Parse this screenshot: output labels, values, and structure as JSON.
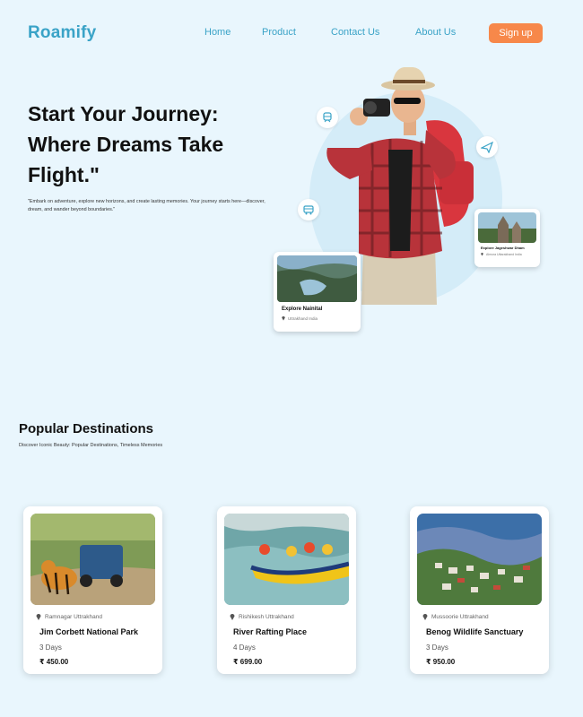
{
  "header": {
    "logo": "Roamify",
    "nav": [
      "Home",
      "Product",
      "Contact Us",
      "About Us"
    ],
    "signup_label": "Sign up"
  },
  "hero": {
    "title": "Start Your Journey: Where Dreams Take Flight.\"",
    "description": "\"Embark on adventure, explore new horizons, and create lasting memories. Your journey starts here—discover, dream, and wander beyond boundaries.\""
  },
  "floating_icons": [
    "train-icon",
    "plane-icon",
    "bus-icon"
  ],
  "feature_cards": [
    {
      "title": "Explore Nainital",
      "location": "Uttrakhand India"
    },
    {
      "title": "Explore Jageshwar Dham",
      "location": "Almora Uttarakhand India"
    }
  ],
  "popular": {
    "title": "Popular Destinations",
    "subtitle": "Discover Iconic Beauty: Popular Destinations, Timeless Memories",
    "cards": [
      {
        "location": "Ramnagar Uttrakhand",
        "name": "Jim Corbett National Park",
        "days": "3 Days",
        "price": "₹ 450.00"
      },
      {
        "location": "Rishikesh Uttrakhand",
        "name": "River Rafting Place",
        "days": "4 Days",
        "price": "₹ 699.00"
      },
      {
        "location": "Mussoorie Uttrakhand",
        "name": "Benog Wildlife Sanctuary",
        "days": "3 Days",
        "price": "₹ 950.00"
      }
    ]
  },
  "colors": {
    "background": "#e9f6fd",
    "brand": "#3aa3c7",
    "accent": "#f7884a"
  }
}
